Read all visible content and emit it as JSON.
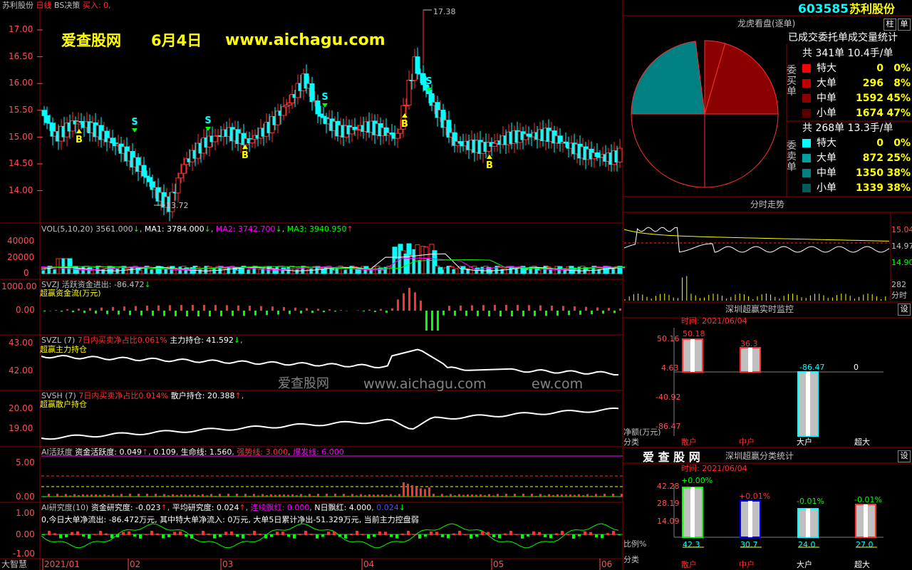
{
  "header": {
    "stock_name": "苏利股份",
    "period": "日线",
    "strategy": "BS决策",
    "buy_label": "买入:",
    "buy_value": "0,",
    "code": "603585",
    "name": "苏利股份",
    "btn_zhu": "柱",
    "btn_dan": "单"
  },
  "watermark": {
    "site": "爱查股网",
    "date": "6月4日",
    "url": "www.aichagu.com",
    "mid_text": "爱查股网",
    "mid_url": "www.aichagu.com",
    "mid_tail": "ew.com"
  },
  "price_axis": [
    "17.00",
    "16.50",
    "16.00",
    "15.50",
    "15.00",
    "14.50",
    "14.00"
  ],
  "price_marks": {
    "high": "17.38",
    "low": "13.72"
  },
  "signals": {
    "buy": "B",
    "sell": "S"
  },
  "vol": {
    "label": "VOL(5,10,20)",
    "value": "3561.000",
    "ma1": "MA1: 3784.000",
    "ma2": "MA2: 3742.700",
    "ma3": "MA3: 3940.950",
    "axis": [
      "40000",
      "20000",
      "0"
    ]
  },
  "svzj": {
    "label": "SVZJ",
    "desc": "活跃资金进出: -86.472",
    "sub": "超赢资金流(万元)",
    "axis": [
      "1000.00",
      "0.00"
    ]
  },
  "svzl": {
    "label": "SVZL (7)",
    "desc": "7日内买卖净占比0.061%",
    "value": "主力持仓: 41.592",
    "sub": "超赢主力持仓",
    "axis": [
      "43.00",
      "42.00"
    ]
  },
  "svsh": {
    "label": "SVSH (7)",
    "desc": "7日内买卖净占比0.014%",
    "value": "散户持仓: 20.388",
    "sub": "超赢散户持仓",
    "axis": [
      "20.00",
      "19.00"
    ]
  },
  "ai_active": {
    "label": "AI活跃度",
    "t1": "资金活跃度: 0.049",
    "t2": "0.109",
    "t3": "生命线: 1.560",
    "t4": "强势线: 3.000",
    "t5": "爆发线: 6.000",
    "axis": [
      "5.00",
      "0.00"
    ]
  },
  "ai_research": {
    "label": "AI研究度(10)",
    "t1": "资金研究度: -0.023",
    "t2": "平均研究度: 0.024",
    "t3": "连续飘红: 0.000",
    "t4": "N日飘红: 4.000",
    "t5": "0.024",
    "line2": "0,今日大单净流出: -86.472万元, 其中特大单净流入: 0万元, 大单5日累计净出-51.329万元, 当前主力控盘弱",
    "axis": [
      "1.00",
      "0.00",
      "-1.00"
    ]
  },
  "x_axis": {
    "left_label": "大智慧",
    "dates": [
      "2021/01",
      "02",
      "03",
      "04",
      "05",
      "06"
    ]
  },
  "dragon": {
    "title": "龙虎看盘(逐单)",
    "subtitle": "已成交委托单成交量统计",
    "buy_side": "委买单",
    "sell_side": "委卖单",
    "buy_total": "共 341单 10.4手/单",
    "sell_total": "共 268单 13.3手/单",
    "buy_rows": [
      {
        "label": "特大",
        "n": "0",
        "p": "0%",
        "color": "#ff0000"
      },
      {
        "label": "大单",
        "n": "296",
        "p": "8%",
        "color": "#c00000"
      },
      {
        "label": "中单",
        "n": "1592",
        "p": "45%",
        "color": "#8b0000"
      },
      {
        "label": "小单",
        "n": "1674",
        "p": "47%",
        "color": "#5a0000"
      }
    ],
    "sell_rows": [
      {
        "label": "特大",
        "n": "0",
        "p": "0%",
        "color": "#00ffff"
      },
      {
        "label": "大单",
        "n": "872",
        "p": "25%",
        "color": "#00a0a0"
      },
      {
        "label": "中单",
        "n": "1350",
        "p": "38%",
        "color": "#008080"
      },
      {
        "label": "小单",
        "n": "1339",
        "p": "38%",
        "color": "#005a5a"
      }
    ]
  },
  "intraday": {
    "title": "分时走势",
    "axis": [
      "15.04",
      "14.97",
      "14.90"
    ],
    "vol_value": "282",
    "vol_label": "分时"
  },
  "monitor": {
    "title": "深圳超赢实时监控",
    "btn": "设",
    "time_label": "时间: 2021/06/04",
    "axis": [
      "50.16",
      "4.63",
      "-40.92",
      "-86.47"
    ],
    "y_unit": "净额(万元)",
    "x_label": "分类",
    "cats": [
      "散户",
      "中户",
      "大户",
      "超大"
    ],
    "values": [
      "50.18",
      "36.3",
      "-86.47",
      "0"
    ]
  },
  "classify": {
    "logo": "爱 查 股 网",
    "title": "深圳超赢分类统计",
    "btn": "设",
    "time_label": "时间: 2021/06/04",
    "axis": [
      "42.28",
      "28.19",
      "14.09"
    ],
    "y_label": "比例%",
    "x_label": "分类",
    "cats": [
      "散户",
      "中户",
      "大户",
      "超大"
    ],
    "pcts": [
      "+0.00%",
      "+0.01%",
      "-0.01%",
      "-0.01%"
    ],
    "values": [
      "42.3",
      "30.7",
      "24.0",
      "27.0"
    ]
  },
  "chart_data": {
    "type": "candlestick",
    "title": "苏利股份 日线",
    "price_range": [
      13.5,
      17.55
    ],
    "high_point": 17.38,
    "low_point": 13.72,
    "months": [
      "2021/01",
      "02",
      "03",
      "04",
      "05",
      "06"
    ],
    "monitor_bars": [
      {
        "cat": "散户",
        "value": 50.18
      },
      {
        "cat": "中户",
        "value": 36.3
      },
      {
        "cat": "大户",
        "value": -86.47
      },
      {
        "cat": "超大",
        "value": 0
      }
    ],
    "classify_bars": [
      {
        "cat": "散户",
        "value": 42.3
      },
      {
        "cat": "中户",
        "value": 30.7
      },
      {
        "cat": "大户",
        "value": 24.0
      },
      {
        "cat": "超大",
        "value": 27.0
      }
    ],
    "pie_buy": [
      {
        "label": "特大",
        "pct": 0
      },
      {
        "label": "大单",
        "pct": 8
      },
      {
        "label": "中单",
        "pct": 45
      },
      {
        "label": "小单",
        "pct": 47
      }
    ],
    "pie_sell": [
      {
        "label": "特大",
        "pct": 0
      },
      {
        "label": "大单",
        "pct": 25
      },
      {
        "label": "中单",
        "pct": 38
      },
      {
        "label": "小单",
        "pct": 38
      }
    ]
  }
}
